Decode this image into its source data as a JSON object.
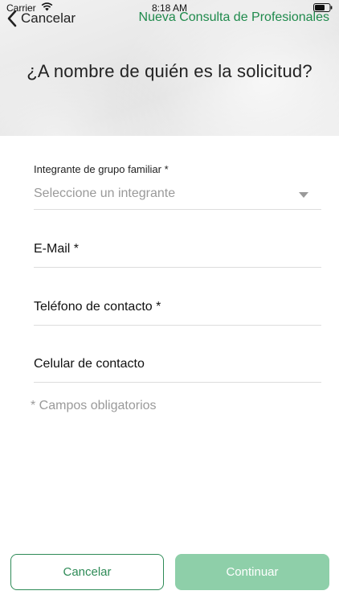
{
  "status_bar": {
    "carrier": "Carrier",
    "time": "8:18 AM"
  },
  "nav": {
    "back_label": "Cancelar",
    "title": "Nueva Consulta de Profesionales"
  },
  "page": {
    "question": "¿A nombre de quién es la solicitud?"
  },
  "form": {
    "family_member": {
      "label": "Integrante de grupo familiar *",
      "placeholder": "Seleccione un integrante"
    },
    "email": {
      "label": "E-Mail *"
    },
    "phone": {
      "label": "Teléfono de contacto *"
    },
    "mobile": {
      "label": "Celular de contacto"
    },
    "required_note": "* Campos obligatorios"
  },
  "buttons": {
    "cancel": "Cancelar",
    "continue": "Continuar"
  },
  "colors": {
    "accent_green": "#1f8a4c",
    "button_border": "#2e8b57",
    "continue_disabled": "#8ecfa9"
  },
  "icons": {
    "wifi": "wifi-icon",
    "battery": "battery-icon",
    "back": "chevron-left-icon",
    "caret": "caret-down-icon"
  }
}
